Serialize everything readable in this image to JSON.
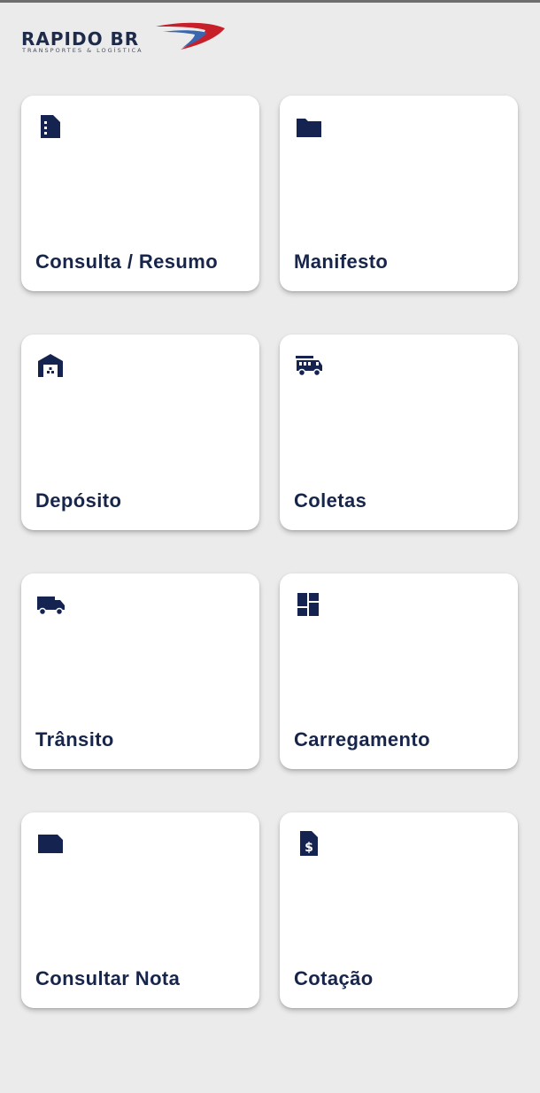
{
  "header": {
    "logo_text": "RAPIDO BR",
    "logo_tagline": "TRANSPORTES & LOGÍSTICA"
  },
  "colors": {
    "background": "#ebebeb",
    "card": "#ffffff",
    "accent_navy": "#152350",
    "logo_red": "#c8202a",
    "logo_blue": "#3a66b0"
  },
  "menu": {
    "items": [
      {
        "label": "Consulta / Resumo",
        "icon": "document-list-icon"
      },
      {
        "label": "Manifesto",
        "icon": "folder-icon"
      },
      {
        "label": "Depósito",
        "icon": "warehouse-icon"
      },
      {
        "label": "Coletas",
        "icon": "fire-truck-icon"
      },
      {
        "label": "Trânsito",
        "icon": "truck-icon"
      },
      {
        "label": "Carregamento",
        "icon": "dashboard-icon"
      },
      {
        "label": "Consultar Nota",
        "icon": "note-icon"
      },
      {
        "label": "Cotação",
        "icon": "receipt-dollar-icon"
      }
    ]
  }
}
